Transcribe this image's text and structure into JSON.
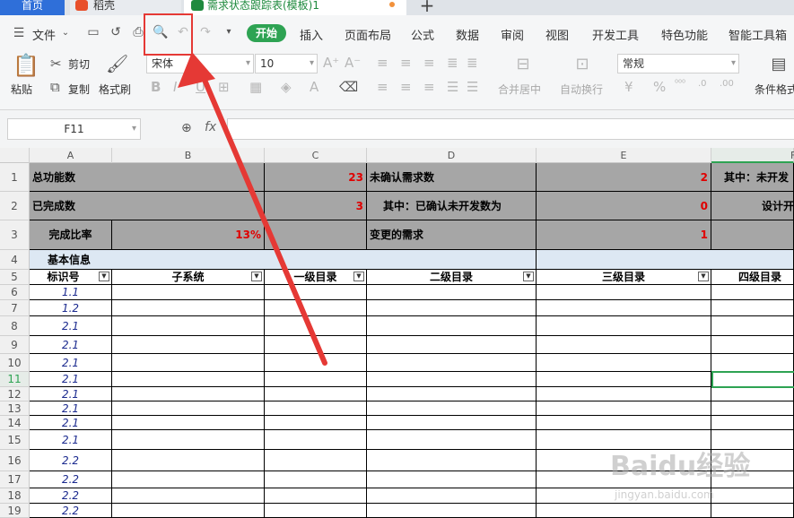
{
  "tabs": {
    "home": "首页",
    "daoke": "稻壳",
    "sheet": "需求状态跟踪表(模板)1",
    "new_tab": "+"
  },
  "menu": {
    "file": "文件",
    "items": [
      "开始",
      "插入",
      "页面布局",
      "公式",
      "数据",
      "审阅",
      "视图",
      "开发工具",
      "特色功能",
      "智能工具箱"
    ]
  },
  "ribbon": {
    "paste": "粘贴",
    "cut": "剪切",
    "copy": "复制",
    "format_painter": "格式刷",
    "font_name": "宋体",
    "font_size": "10",
    "merge": "合并居中",
    "wrap": "自动换行",
    "number_format": "常规",
    "conditional": "条件格式",
    "bold": "B",
    "italic": "I",
    "underline": "U",
    "inc_font": "A⁺",
    "dec_font": "A⁻",
    "currency": "¥",
    "percent": "%"
  },
  "formula_bar": {
    "cell_ref": "F11",
    "fx": "fx",
    "zoom_icon": "magnifier-icon"
  },
  "columns": [
    "A",
    "B",
    "C",
    "D",
    "E",
    "F"
  ],
  "rows": [
    "1",
    "2",
    "3",
    "4",
    "5",
    "6",
    "7",
    "8",
    "9",
    "10",
    "11",
    "12",
    "13",
    "14",
    "15",
    "16",
    "17",
    "18",
    "19"
  ],
  "summary": {
    "total_label": "总功能数",
    "total_value": "23",
    "unconfirmed_label": "未确认需求数",
    "unconfirmed_value": "2",
    "not_dev_label": "其中：未开发",
    "done_label": "已完成数",
    "done_value": "3",
    "confirmed_label": "其中：已确认未开发数为",
    "confirmed_value": "0",
    "design_label": "设计开",
    "ratio_label": "完成比率",
    "ratio_value": "13%",
    "changed_label": "变更的需求",
    "changed_value": "1"
  },
  "basic_info": "基本信息",
  "headers": [
    "标识号",
    "子系统",
    "一级目录",
    "二级目录",
    "三级目录",
    "四级目录"
  ],
  "ids": [
    "1.1",
    "1.2",
    "2.1",
    "2.1",
    "2.1",
    "2.1",
    "2.1",
    "2.1",
    "2.1",
    "2.1",
    "2.2",
    "2.2",
    "2.2",
    "2.2"
  ],
  "watermark": "Baidu经验",
  "watermark_url": "jingyan.baidu.com",
  "colors": {
    "accent": "#2ea353",
    "tab_blue": "#2f6fd9",
    "highlight": "#e53935",
    "arrow": "#e53935"
  }
}
